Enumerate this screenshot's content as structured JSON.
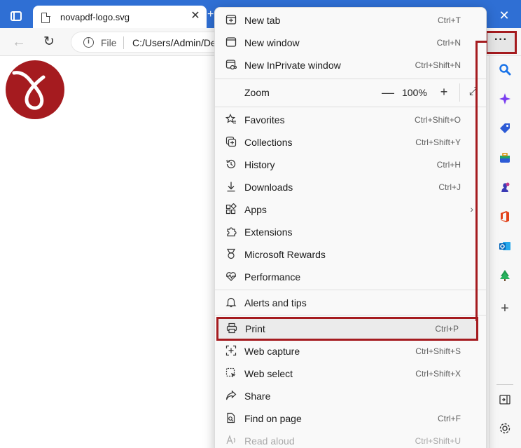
{
  "tab": {
    "title": "novapdf-logo.svg",
    "close": "✕",
    "new_tab": "+"
  },
  "window": {
    "close": "✕"
  },
  "toolbar": {
    "back": "←",
    "refresh": "↻",
    "info": "i",
    "file_label": "File",
    "url": "C:/Users/Admin/De",
    "more": "···"
  },
  "menu": {
    "new_tab": {
      "label": "New tab",
      "shortcut": "Ctrl+T"
    },
    "new_window": {
      "label": "New window",
      "shortcut": "Ctrl+N"
    },
    "new_inprivate": {
      "label": "New InPrivate window",
      "shortcut": "Ctrl+Shift+N"
    },
    "zoom": {
      "label": "Zoom",
      "minus": "—",
      "value": "100%",
      "plus": "+",
      "fullscreen": "⤢"
    },
    "favorites": {
      "label": "Favorites",
      "shortcut": "Ctrl+Shift+O"
    },
    "collections": {
      "label": "Collections",
      "shortcut": "Ctrl+Shift+Y"
    },
    "history": {
      "label": "History",
      "shortcut": "Ctrl+H"
    },
    "downloads": {
      "label": "Downloads",
      "shortcut": "Ctrl+J"
    },
    "apps": {
      "label": "Apps",
      "arrow": "›"
    },
    "extensions": {
      "label": "Extensions"
    },
    "rewards": {
      "label": "Microsoft Rewards"
    },
    "performance": {
      "label": "Performance"
    },
    "alerts": {
      "label": "Alerts and tips"
    },
    "print": {
      "label": "Print",
      "shortcut": "Ctrl+P"
    },
    "web_capture": {
      "label": "Web capture",
      "shortcut": "Ctrl+Shift+S"
    },
    "web_select": {
      "label": "Web select",
      "shortcut": "Ctrl+Shift+X"
    },
    "share": {
      "label": "Share"
    },
    "find": {
      "label": "Find on page",
      "shortcut": "Ctrl+F"
    },
    "read_aloud": {
      "label": "Read aloud",
      "shortcut": "Ctrl+Shift+U"
    }
  },
  "sidebar": {
    "add": "+"
  },
  "colors": {
    "accent": "#2f6fd4",
    "highlight": "#a51b1f",
    "logo": "#a51b1f"
  }
}
